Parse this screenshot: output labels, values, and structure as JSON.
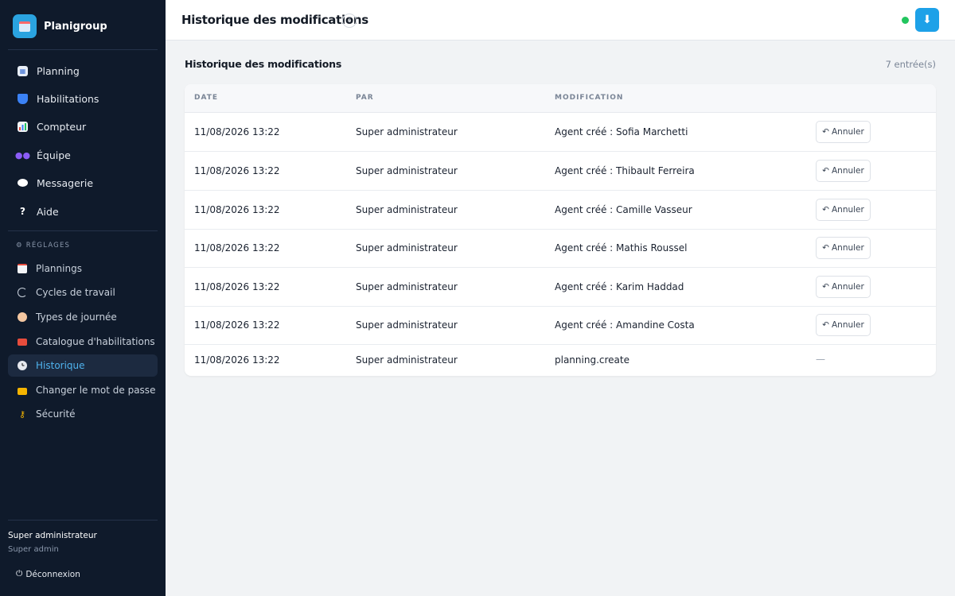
{
  "app": {
    "name": "Planigroup"
  },
  "nav": {
    "main": [
      {
        "label": "Planning",
        "icon": "calendar-icon"
      },
      {
        "label": "Habilitations",
        "icon": "shield-icon"
      },
      {
        "label": "Compteur",
        "icon": "bar-chart-icon"
      },
      {
        "label": "Équipe",
        "icon": "people-icon"
      },
      {
        "label": "Messagerie",
        "icon": "chat-bubble-icon"
      },
      {
        "label": "Aide",
        "icon": "question-icon"
      }
    ],
    "section_label": "⚙ RÉGLAGES",
    "settings": [
      {
        "label": "Plannings",
        "icon": "clipboard-icon"
      },
      {
        "label": "Cycles de travail",
        "icon": "refresh-icon"
      },
      {
        "label": "Types de journée",
        "icon": "palette-icon"
      },
      {
        "label": "Catalogue d'habilitations",
        "icon": "toolbox-icon"
      },
      {
        "label": "Historique",
        "icon": "clock-icon",
        "active": true
      },
      {
        "label": "Changer le mot de passe",
        "icon": "lock-icon"
      },
      {
        "label": "Sécurité",
        "icon": "key-icon"
      }
    ]
  },
  "user": {
    "name": "Super administrateur",
    "role": "Super admin",
    "logout_label": "Déconnexion"
  },
  "header": {
    "title": "Historique des modifications",
    "help": "?",
    "status_color": "#22c55e"
  },
  "main": {
    "section_title": "Historique des modifications",
    "entries_count": "7 entrée(s)",
    "columns": [
      "DATE",
      "PAR",
      "MODIFICATION"
    ],
    "rows": [
      {
        "date": "11/08/2026 13:22",
        "by": "Super administrateur",
        "change": "Agent créé : Sofia Marchetti",
        "action": "Annuler"
      },
      {
        "date": "11/08/2026 13:22",
        "by": "Super administrateur",
        "change": "Agent créé : Thibault Ferreira",
        "action": "Annuler"
      },
      {
        "date": "11/08/2026 13:22",
        "by": "Super administrateur",
        "change": "Agent créé : Camille Vasseur",
        "action": "Annuler"
      },
      {
        "date": "11/08/2026 13:22",
        "by": "Super administrateur",
        "change": "Agent créé : Mathis Roussel",
        "action": "Annuler"
      },
      {
        "date": "11/08/2026 13:22",
        "by": "Super administrateur",
        "change": "Agent créé : Karim Haddad",
        "action": "Annuler"
      },
      {
        "date": "11/08/2026 13:22",
        "by": "Super administrateur",
        "change": "Agent créé : Amandine Costa",
        "action": "Annuler"
      },
      {
        "date": "11/08/2026 13:22",
        "by": "Super administrateur",
        "change": "planning.create",
        "action": "—"
      }
    ]
  },
  "colors": {
    "accent": "#1da1e8",
    "sidebar_bg": "#0f1a2b",
    "active_text": "#4fb3ee"
  }
}
